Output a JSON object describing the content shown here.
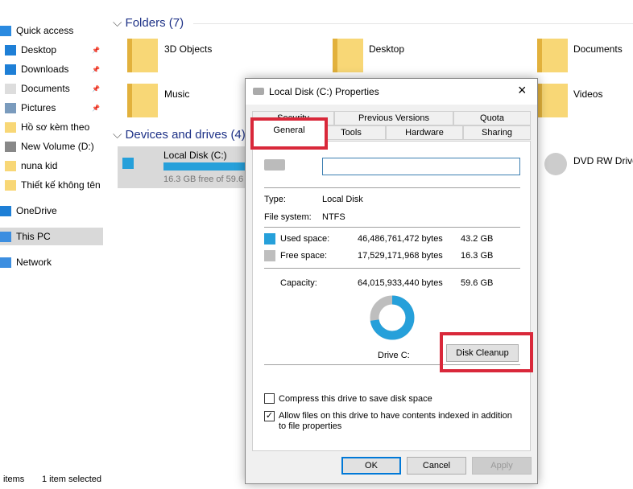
{
  "sidebar": {
    "items": [
      {
        "label": "Quick access",
        "icon": "star-icon"
      },
      {
        "label": "Desktop",
        "icon": "desktop-icon",
        "pinned": true
      },
      {
        "label": "Downloads",
        "icon": "download-icon",
        "pinned": true
      },
      {
        "label": "Documents",
        "icon": "document-icon",
        "pinned": true
      },
      {
        "label": "Pictures",
        "icon": "pictures-icon",
        "pinned": true
      },
      {
        "label": "Hồ sơ kèm theo",
        "icon": "folder-icon"
      },
      {
        "label": "New Volume (D:)",
        "icon": "drive-icon"
      },
      {
        "label": "nuna kid",
        "icon": "folder-icon"
      },
      {
        "label": "Thiết kế không tên (",
        "icon": "folder-icon"
      },
      {
        "label": "OneDrive",
        "icon": "cloud-icon"
      },
      {
        "label": "This PC",
        "icon": "computer-icon",
        "selected": true
      },
      {
        "label": "Network",
        "icon": "network-icon"
      }
    ]
  },
  "main": {
    "folders_header": "Folders (7)",
    "folders": [
      "3D Objects",
      "Desktop",
      "Documents",
      "Music",
      "Videos"
    ],
    "drives_header": "Devices and drives (4)",
    "drive_c": {
      "name": "Local Disk (C:)",
      "free": "16.3 GB free of 59.6",
      "used_fraction": 0.726
    },
    "dvd": "DVD RW Drive"
  },
  "status": {
    "items": "items",
    "selected": "1 item selected"
  },
  "dialog": {
    "title": "Local Disk (C:) Properties",
    "tabs_back": [
      "Security",
      "Previous Versions",
      "Quota"
    ],
    "tabs_front": [
      "General",
      "Tools",
      "Hardware",
      "Sharing"
    ],
    "active_tab": "General",
    "name_value": "",
    "type_label": "Type:",
    "type_value": "Local Disk",
    "fs_label": "File system:",
    "fs_value": "NTFS",
    "used_label": "Used space:",
    "used_bytes": "46,486,761,472 bytes",
    "used_gb": "43.2 GB",
    "free_label": "Free space:",
    "free_bytes": "17,529,171,968 bytes",
    "free_gb": "16.3 GB",
    "cap_label": "Capacity:",
    "cap_bytes": "64,015,933,440 bytes",
    "cap_gb": "59.6 GB",
    "drive_label": "Drive C:",
    "cleanup": "Disk Cleanup",
    "compress": "Compress this drive to save disk space",
    "compress_checked": false,
    "index": "Allow files on this drive to have contents indexed in addition to file properties",
    "index_checked": true,
    "ok": "OK",
    "cancel": "Cancel",
    "apply": "Apply",
    "colors": {
      "used": "#26a0da",
      "free": "#bebebe",
      "highlight": "#d9283a"
    }
  }
}
